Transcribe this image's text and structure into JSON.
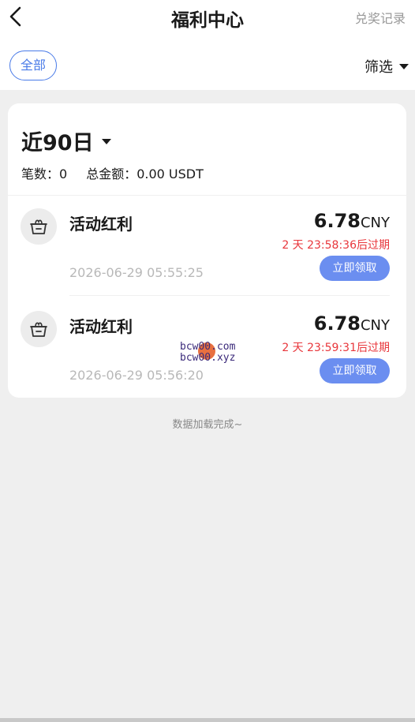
{
  "header": {
    "title": "福利中心",
    "redeem_history": "兑奖记录",
    "back_icon": "chevron-left-icon"
  },
  "filters": {
    "all_chip": "全部",
    "filter_label": "筛选"
  },
  "summary": {
    "period": "近90日",
    "count_label": "笔数：",
    "count_value": "0",
    "total_label": "总金额：",
    "total_value": "0.00 USDT"
  },
  "items": [
    {
      "icon": "gift-box-icon",
      "title": "活动红利",
      "amount": "6.78",
      "unit": "CNY",
      "expire": "2 天 23:58:36后过期",
      "date": "2026-06-29 05:55:25",
      "claim_label": "立即领取"
    },
    {
      "icon": "gift-box-icon",
      "title": "活动红利",
      "amount": "6.78",
      "unit": "CNY",
      "expire": "2 天 23:59:31后过期",
      "date": "2026-06-29 05:56:20",
      "claim_label": "立即领取"
    }
  ],
  "watermark": {
    "line1": "bcw00.com",
    "line2": "bcw00.xyz"
  },
  "footer": {
    "load_done": "数据加载完成~"
  },
  "colors": {
    "accent": "#4a7be8",
    "button": "#6b8ef0",
    "expire": "#e8363b",
    "background": "#efefef"
  }
}
